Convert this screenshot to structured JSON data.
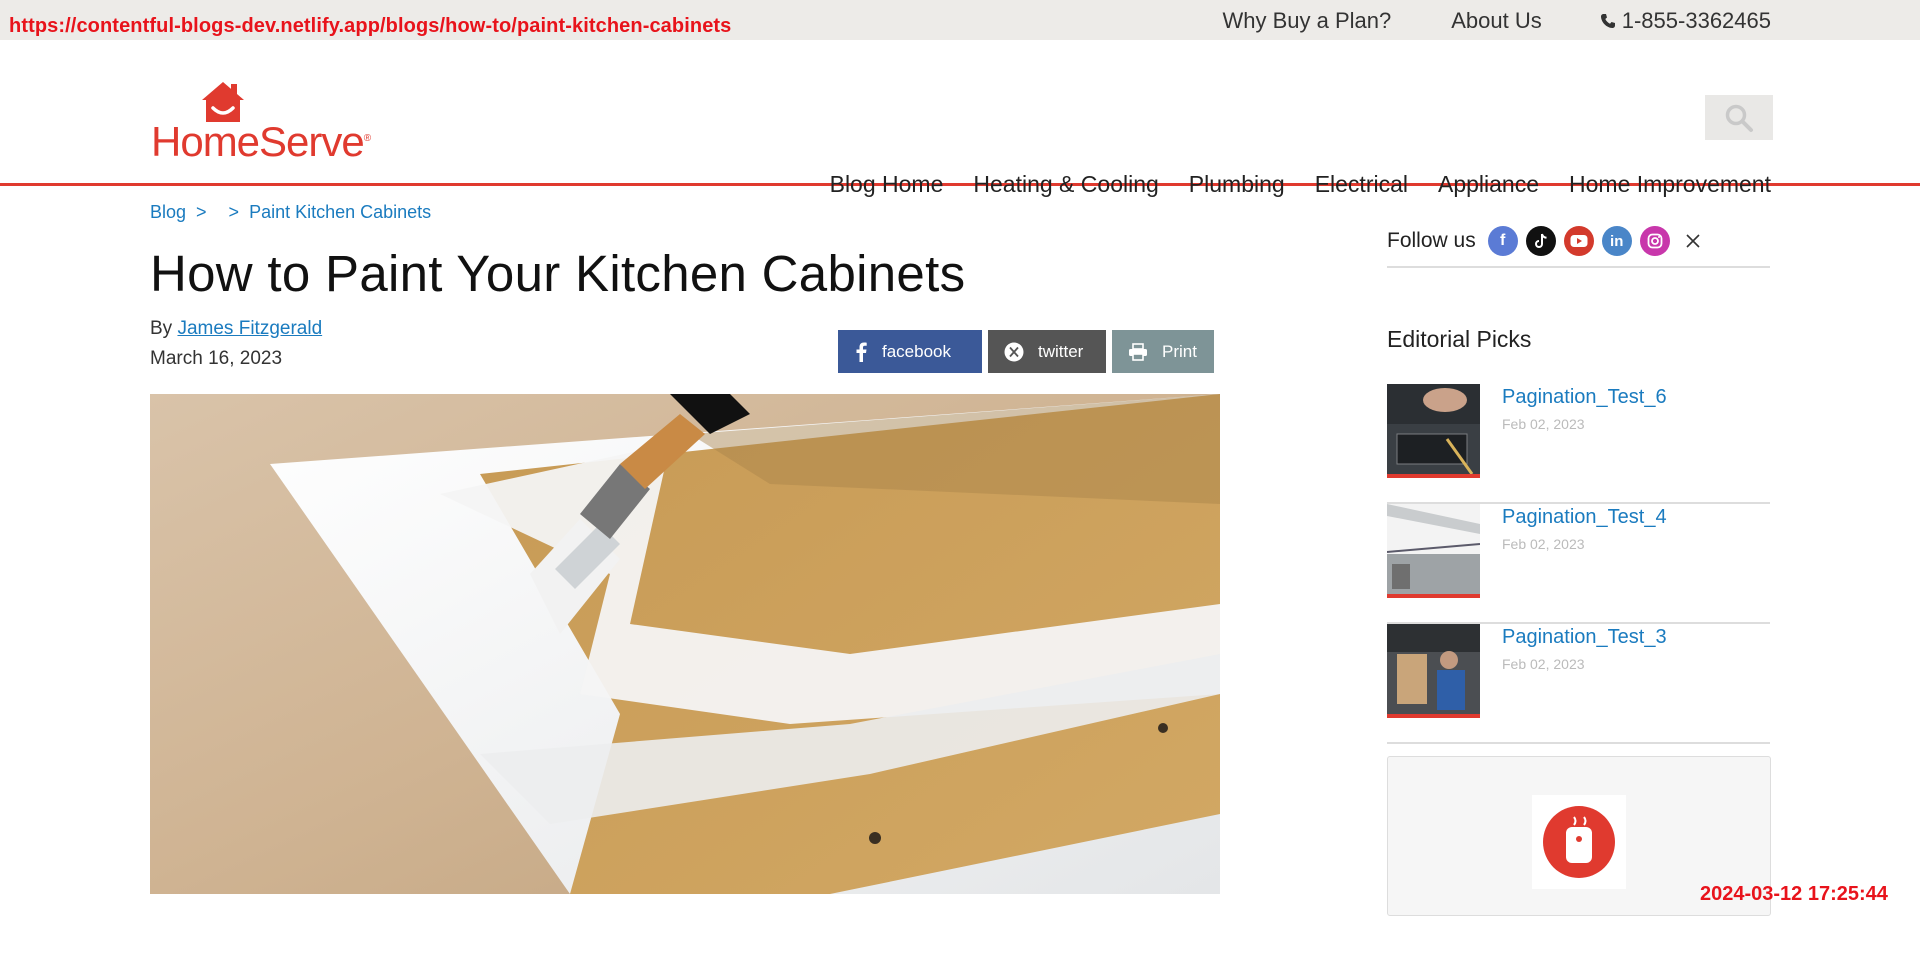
{
  "browser": {
    "url": "https://contentful-blogs-dev.netlify.app/blogs/how-to/paint-kitchen-cabinets",
    "timestamp": "2024-03-12 17:25:44"
  },
  "utility_nav": {
    "items": [
      "Why Buy a Plan?",
      "About Us"
    ],
    "phone": "1-855-3362465"
  },
  "brand": {
    "name": "HomeServe",
    "reg": "®",
    "color": "#e03a2f"
  },
  "main_nav": {
    "items": [
      "Blog Home",
      "Heating & Cooling",
      "Plumbing",
      "Electrical",
      "Appliance",
      "Home Improvement"
    ]
  },
  "breadcrumb": {
    "items": [
      "Blog",
      ">",
      ">",
      "Paint Kitchen Cabinets"
    ]
  },
  "article": {
    "title": "How to Paint Your Kitchen Cabinets",
    "by_label": "By",
    "author": "James Fitzgerald",
    "date": "March 16, 2023"
  },
  "share": {
    "facebook": "facebook",
    "twitter": "twitter",
    "print": "Print"
  },
  "sidebar": {
    "follow_label": "Follow us",
    "social_icons": [
      "facebook-icon",
      "tiktok-icon",
      "youtube-icon",
      "linkedin-icon",
      "instagram-icon",
      "x-icon"
    ],
    "editorial_title": "Editorial Picks",
    "picks": [
      {
        "title": "Pagination_Test_6",
        "date": "Feb 02, 2023"
      },
      {
        "title": "Pagination_Test_4",
        "date": "Feb 02, 2023"
      },
      {
        "title": "Pagination_Test_3",
        "date": "Feb 02, 2023"
      }
    ]
  },
  "colors": {
    "accent_red": "#e03a2f",
    "link_blue": "#1a7bbf",
    "facebook_blue": "#3b5998",
    "twitter_gray": "#555555",
    "print_gray": "#7e9497"
  }
}
